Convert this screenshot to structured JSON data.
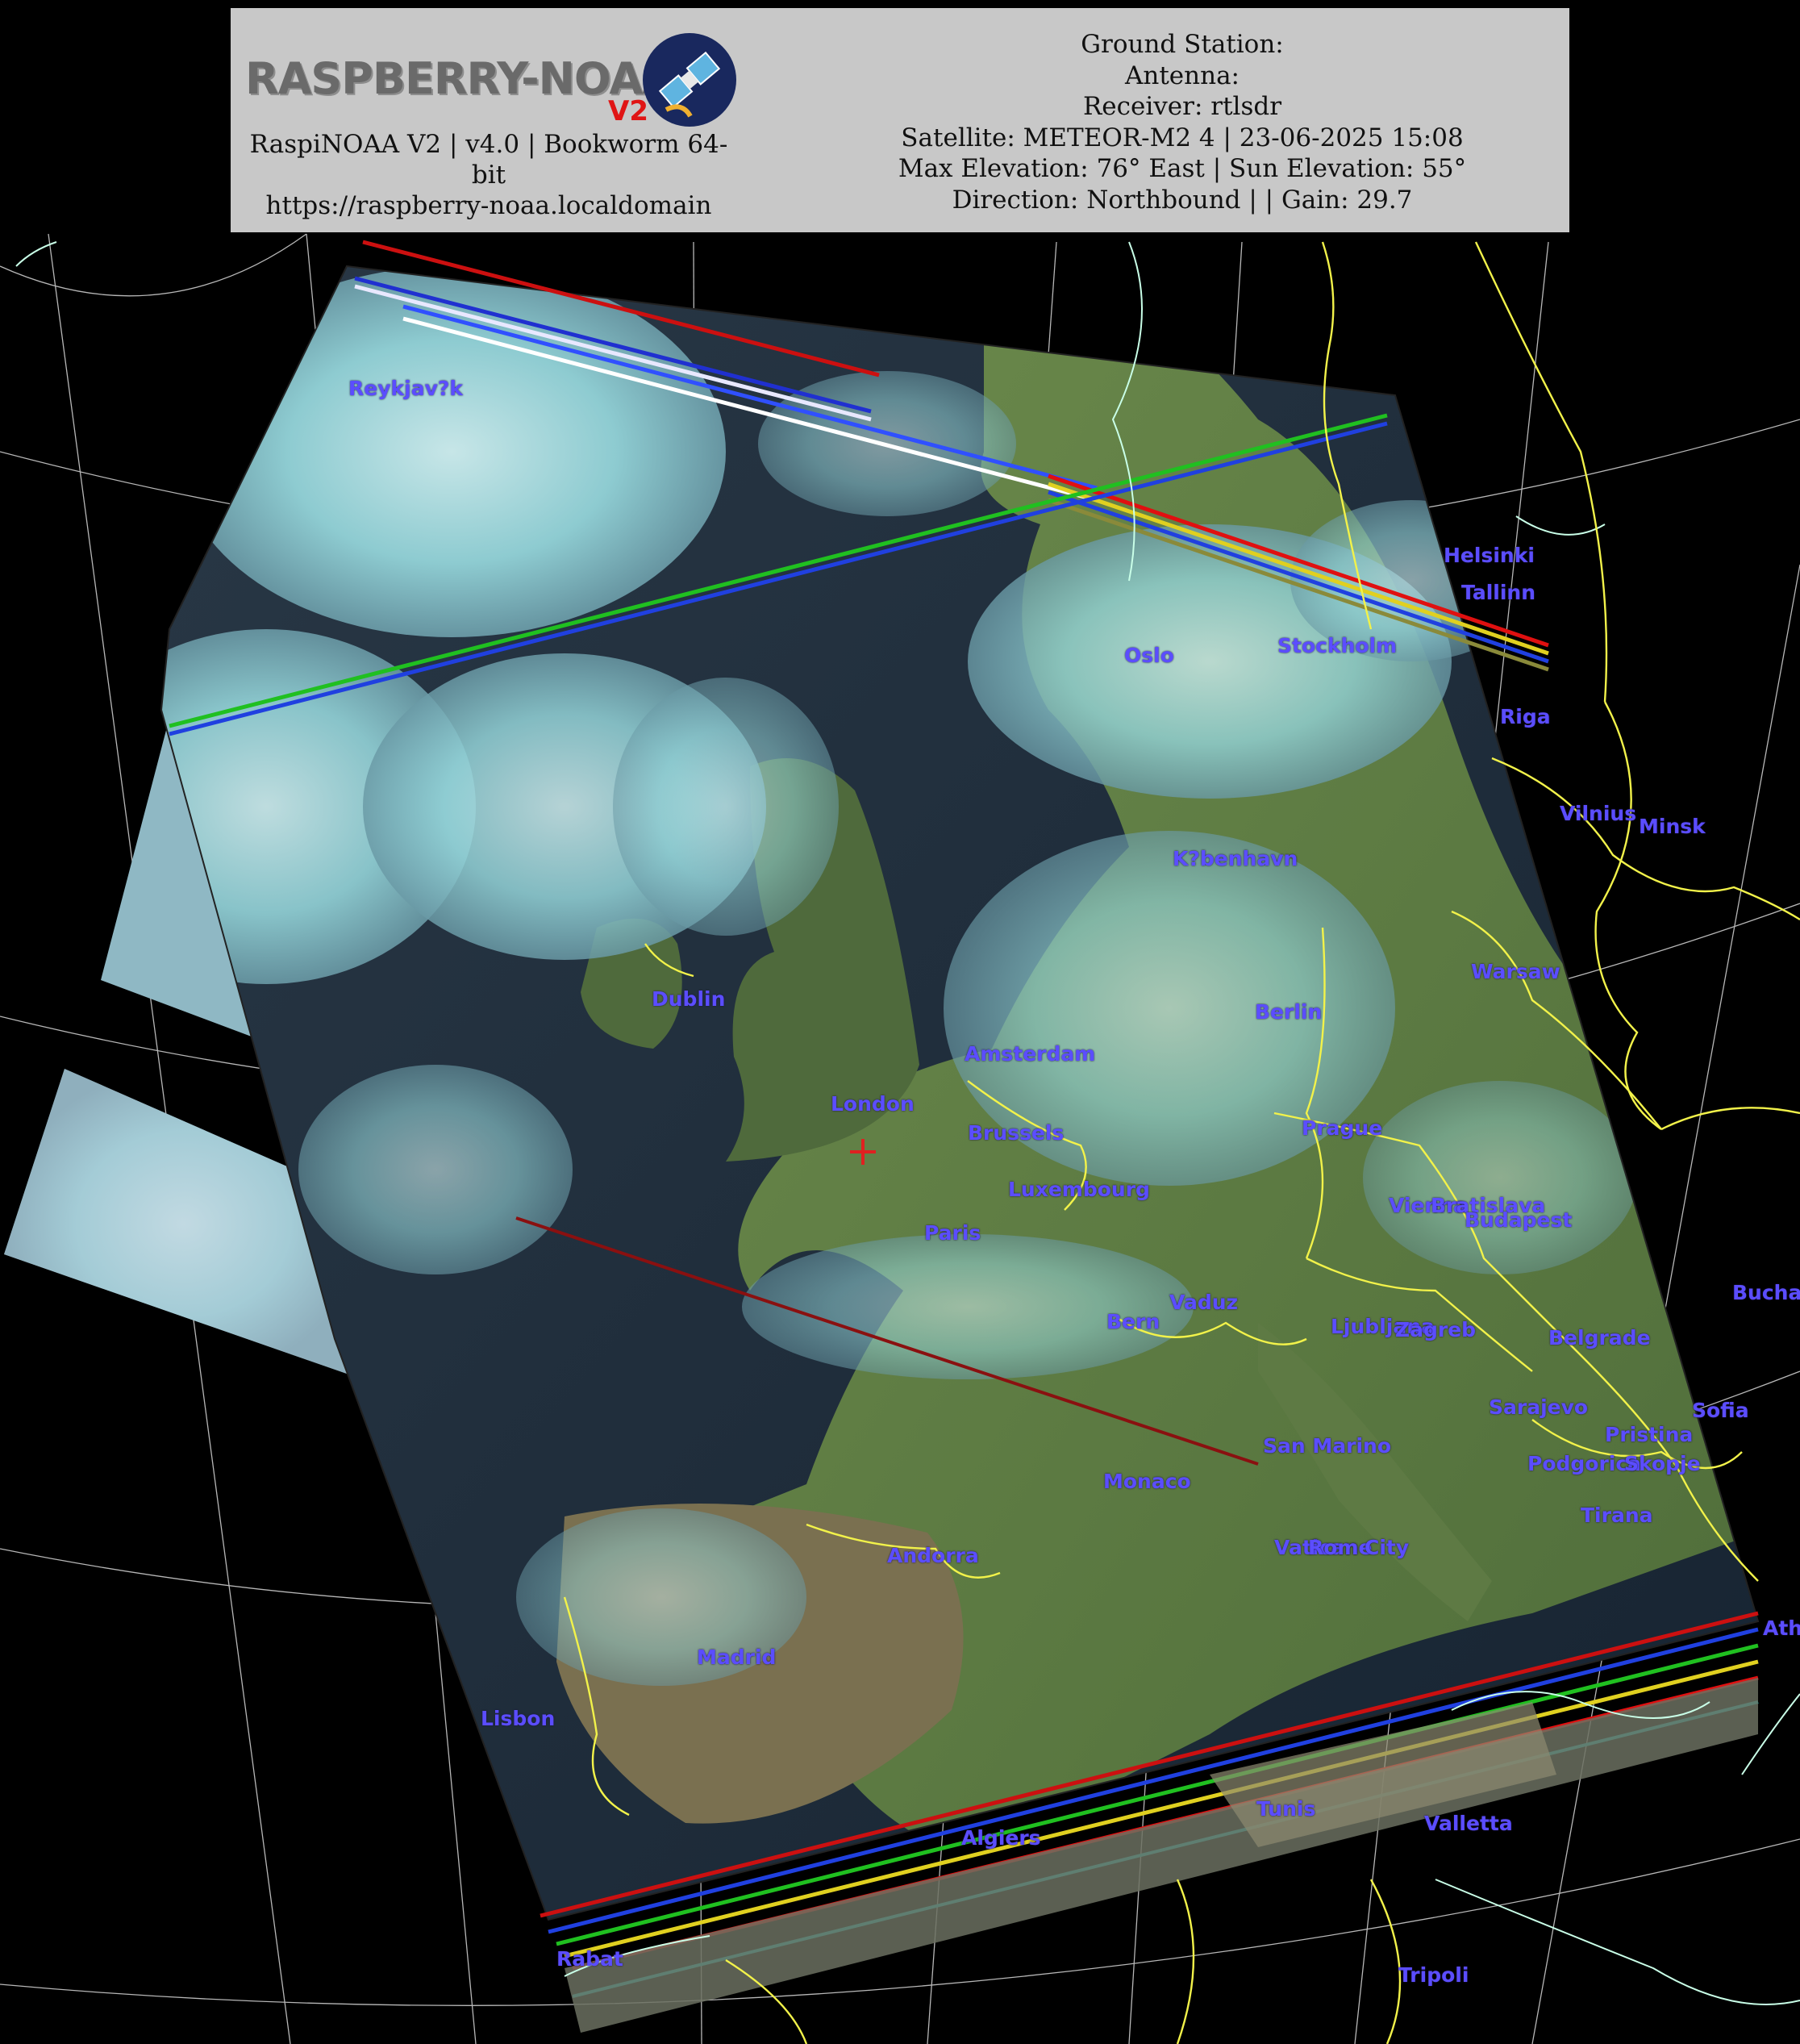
{
  "header": {
    "logo_text": "RASPBERRY-NOAA",
    "logo_suffix": "V2",
    "left_lines": [
      "RaspiNOAA V2 | v4.0 | Bookworm 64-",
      "bit",
      "https://raspberry-noaa.localdomain"
    ],
    "right_lines": [
      "Ground Station:",
      "Antenna:",
      "Receiver: rtlsdr",
      "Satellite: METEOR-M2 4 | 23-06-2025 15:08",
      "Max Elevation: 76° East | Sun Elevation: 55°",
      "Direction: Northbound | | Gain: 29.7"
    ]
  },
  "map": {
    "colors": {
      "background": "#000000",
      "cloud": "#a9e6e8",
      "land": "#5f7f45",
      "sea": "#1e2a38",
      "border": "#f2f24a",
      "coast": "#c9ffe8",
      "city_label": "#5b4dff",
      "marker": "#e02020"
    },
    "station_marker_icon": "red-cross"
  },
  "cities": [
    "Reykjav?k",
    "Helsinki",
    "Tallinn",
    "Oslo",
    "Stockholm",
    "Riga",
    "Vilnius",
    "Minsk",
    "K?benhavn",
    "Warsaw",
    "Berlin",
    "Dublin",
    "Amsterdam",
    "London",
    "Brussels",
    "Luxembourg",
    "Prague",
    "Paris",
    "Vienna",
    "Bratislava",
    "Budapest",
    "Bucha",
    "Vaduz",
    "Bern",
    "Ljubljana",
    "Zagreb",
    "Belgrade",
    "Sarajevo",
    "Sofia",
    "Pristina",
    "Podgorica",
    "Skopje",
    "San Marino",
    "Monaco",
    "Tirana",
    "Vatican",
    "Rome",
    "City",
    "Andorra",
    "Athe",
    "Madrid",
    "Lisbon",
    "Tunis",
    "Valletta",
    "Algiers",
    "Rabat",
    "Tripoli"
  ]
}
